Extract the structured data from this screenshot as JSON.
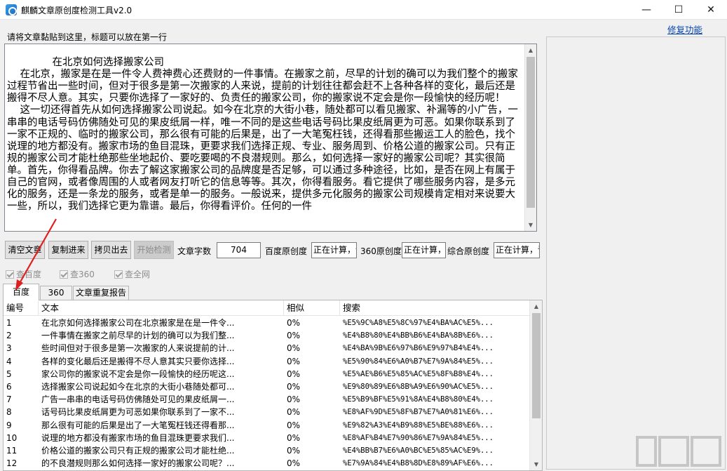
{
  "window": {
    "title": "麒麟文章原创度检测工具v2.0",
    "minimize": "—",
    "maximize": "☐",
    "close": "✕"
  },
  "header": {
    "hint": "请将文章黏贴到这里，标题可以放在第一行",
    "fix_link": "修复功能"
  },
  "editor": {
    "content": "            在北京如何选择搬家公司\n    在北京，搬家是在是一件令人费神费心还费财的一件事情。在搬家之前，尽早的计划的确可以为我们整个的搬家过程节省出一些时间，但对于很多是第一次搬家的人来说，提前的计划往往都会赶不上各种各样的变化，最后还是搬得不尽人意。其实，只要你选择了一家好的、负责任的搬家公司，你的搬家说不定会是你一段愉快的经历呢！\n    这一切还得首先从如何选择搬家公司说起。如今在北京的大街小巷，随处都可以看见搬家、补漏等的小广告，一串串的电话号码仿佛随处可见的果皮纸屑一样，唯一不同的是这些电话号码比果皮纸屑更为可恶。如果你联系到了一家不正规的、临时的搬家公司，那么很有可能的后果是，出了一大笔冤枉钱，还得看那些搬运工人的脸色，找个说理的地方都没有。搬家市场的鱼目混珠，更要求我们选择正规、专业、服务周到、价格公道的搬家公司。只有正规的搬家公司才能杜绝那些坐地起价、要吃要喝的不良潜规则。那么，如何选择一家好的搬家公司呢？其实很简单。首先，你得看品牌。你去了解这家搬家公司的品牌度是否足够，可以通过多种途径，比如，是否在网上有属于自己的官网，或者像周围的人或者网友打听它的信息等等。其次，你得看服务。看它提供了哪些服务内容，是多元化的服务，还是一条龙的服务，或者是单一的服务。一般说来，提供多元化服务的搬家公司规模肯定相对来说要大一些，所以，我们选择它更为靠谱。最后，你得看评价。任何的一件"
  },
  "toolbar": {
    "clear": "清空文章",
    "copy_in": "复制进来",
    "copy_out": "拷贝出去",
    "start": "开始检测",
    "word_count_label": "文章字数",
    "word_count": "704",
    "baidu_label": "百度原创度",
    "baidu_value": "正在计算，请",
    "s360_label": "360原创度",
    "s360_value": "正在计算，请",
    "overall_label": "综合原创度",
    "overall_value": "正在计算，请"
  },
  "checks": {
    "baidu": "查百度",
    "s360": "查360",
    "all": "查全网"
  },
  "tabs": [
    {
      "label": "百度"
    },
    {
      "label": "360"
    },
    {
      "label": "文章重复报告"
    }
  ],
  "table": {
    "headers": [
      "编号",
      "文本",
      "相似",
      "搜索"
    ],
    "rows": [
      {
        "no": "1",
        "text": "在北京如何选择搬家公司在北京搬家是在是一件令...",
        "sim": "0%",
        "search": "%E5%9C%A8%E5%8C%97%E4%BA%AC%E5%..."
      },
      {
        "no": "2",
        "text": "一件事情在搬家之前尽早的计划的确可以为我们整...",
        "sim": "0%",
        "search": "%E4%B8%80%E4%BB%B6%E4%BA%8B%E6%..."
      },
      {
        "no": "3",
        "text": "些时间但对于很多是第一次搬家的人来说提前的计...",
        "sim": "0%",
        "search": "%E4%BA%9B%E6%97%B6%E9%97%B4%E4%..."
      },
      {
        "no": "4",
        "text": "各样的变化最后还是搬得不尽人意其实只要你选择...",
        "sim": "0%",
        "search": "%E5%90%84%E6%A0%B7%E7%9A%84%E5%..."
      },
      {
        "no": "5",
        "text": "家公司你的搬家说不定会是你一段愉快的经历呢这...",
        "sim": "0%",
        "search": "%E5%AE%B6%E5%85%AC%E5%8F%B8%E4%..."
      },
      {
        "no": "6",
        "text": "选择搬家公司说起如今在北京的大街小巷随处都可...",
        "sim": "0%",
        "search": "%E9%80%89%E6%8B%A9%E6%90%AC%E5%..."
      },
      {
        "no": "7",
        "text": "广告一串串的电话号码仿佛随处可见的果皮纸屑一...",
        "sim": "0%",
        "search": "%E5%B9%BF%E5%91%8A%E4%B8%80%E4%..."
      },
      {
        "no": "8",
        "text": "话号码比果皮纸屑更为可恶如果你联系到了一家不...",
        "sim": "0%",
        "search": "%E8%AF%9D%E5%8F%B7%E7%A0%81%E6%..."
      },
      {
        "no": "9",
        "text": "那么很有可能的后果是出了一大笔冤枉钱还得看那...",
        "sim": "0%",
        "search": "%E9%82%A3%E4%B9%88%E5%BE%88%E6%..."
      },
      {
        "no": "10",
        "text": "说理的地方都没有搬家市场的鱼目混珠更要求我们...",
        "sim": "0%",
        "search": "%E8%AF%B4%E7%90%86%E7%9A%84%E5%..."
      },
      {
        "no": "11",
        "text": "价格公道的搬家公司只有正规的搬家公司才能杜绝...",
        "sim": "0%",
        "search": "%E4%BB%B7%E6%A0%BC%E5%85%AC%E9%..."
      },
      {
        "no": "12",
        "text": "的不良潜规则那么如何选择一家好的搬家公司呢？...",
        "sim": "0%",
        "search": "%E7%9A%84%E4%B8%8D%E8%89%AF%E6%..."
      }
    ]
  },
  "colors": {
    "link": "#0645ad",
    "annotation_arrow": "#e0201e"
  }
}
